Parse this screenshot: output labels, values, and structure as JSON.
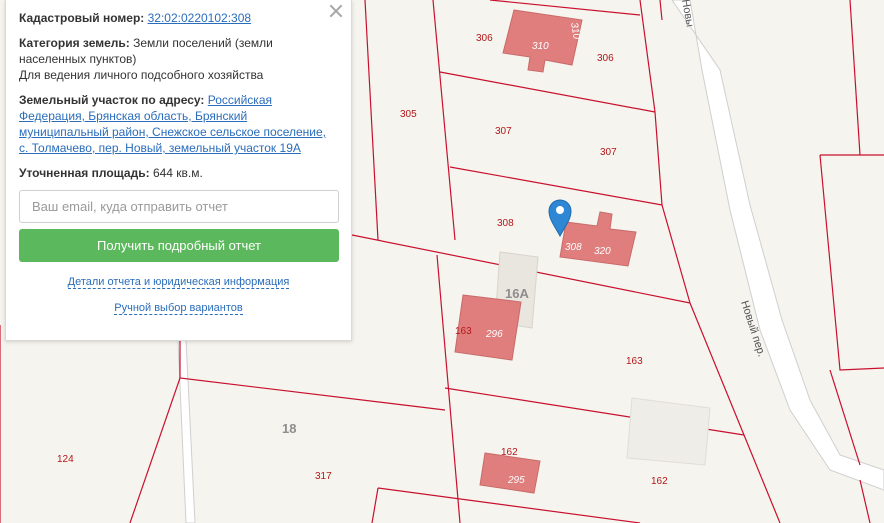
{
  "map": {
    "parcel_labels": [
      "306",
      "306",
      "305",
      "307",
      "307",
      "308",
      "308",
      "163",
      "163",
      "124",
      "317",
      "162",
      "162"
    ],
    "building_labels": [
      "310",
      "310",
      "320",
      "296",
      "295"
    ],
    "house_numbers": [
      "16А",
      "18"
    ],
    "street_labels": [
      "Новый пер.",
      "Новы"
    ],
    "marker": "map-pin-icon",
    "colors": {
      "background": "#f6f4ee",
      "boundary": "#c8102e",
      "building": "#e07e7e",
      "road": "#d2d2d2",
      "marker": "#2d87d4"
    }
  },
  "panel": {
    "cadastral_label": "Кадастровый номер:",
    "cadastral_value": "32:02:0220102:308",
    "category_label": "Категория земель:",
    "category_value": "Земли поселений (земли населенных пунктов)",
    "usage": "Для ведения личного подсобного хозяйства",
    "address_label": "Земельный участок по адресу:",
    "address_value": "Российская Федерация, Брянская область, Брянский муниципальный район, Снежское сельское поселение, с. Толмачево, пер. Новый, земельный участок 19А",
    "area_label": "Уточненная площадь:",
    "area_value": "644 кв.м.",
    "email_placeholder": "Ваш email, куда отправить отчет",
    "submit_label": "Получить подробный отчет",
    "details_link": "Детали отчета и юридическая информация",
    "manual_link": "Ручной выбор вариантов",
    "close_icon": "close-icon",
    "colors": {
      "button": "#5cb85c",
      "link": "#2a6dbb"
    }
  }
}
